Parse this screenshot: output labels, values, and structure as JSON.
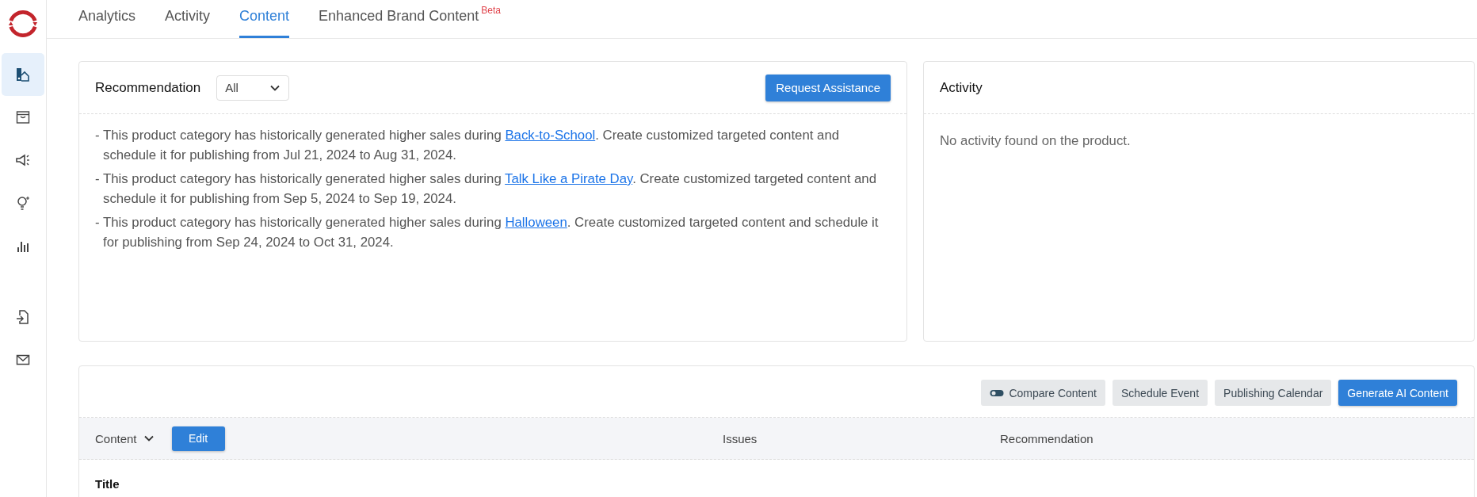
{
  "sidebar": {
    "items": [
      {
        "kind": "swatch",
        "selected": true
      },
      {
        "kind": "archive",
        "selected": false
      },
      {
        "kind": "megaphone",
        "selected": false
      },
      {
        "kind": "bulb",
        "selected": false
      },
      {
        "kind": "chart",
        "selected": false
      },
      {
        "kind": "import",
        "selected": false
      },
      {
        "kind": "mail",
        "selected": false
      }
    ]
  },
  "tabs": [
    {
      "label": "Analytics",
      "selected": false
    },
    {
      "label": "Activity",
      "selected": false
    },
    {
      "label": "Content",
      "selected": true
    },
    {
      "label": "Enhanced Brand Content",
      "selected": false,
      "badge": "Beta"
    }
  ],
  "recommendation": {
    "title": "Recommendation",
    "filter": "All",
    "button": "Request Assistance",
    "items": [
      {
        "before": "- This product category has historically generated higher sales during ",
        "link": "Back-to-School",
        "after": ". Create customized targeted content and schedule it for publishing from Jul 21, 2024 to Aug 31, 2024."
      },
      {
        "before": "- This product category has historically generated higher sales during ",
        "link": "Talk Like a Pirate Day",
        "after": ". Create customized targeted content and schedule it for publishing from Sep 5, 2024 to Sep 19, 2024."
      },
      {
        "before": "- This product category has historically generated higher sales during ",
        "link": "Halloween",
        "after": ". Create customized targeted content and schedule it for publishing from Sep 24, 2024 to Oct 31, 2024."
      }
    ]
  },
  "activity": {
    "title": "Activity",
    "message": "No activity found on the product."
  },
  "content": {
    "toolbar": [
      {
        "label": "Compare Content",
        "kind": "toggle"
      },
      {
        "label": "Schedule Event",
        "kind": "plain"
      },
      {
        "label": "Publishing Calendar",
        "kind": "plain"
      },
      {
        "label": "Generate AI Content",
        "kind": "primary"
      }
    ],
    "columns": [
      "Content",
      "Issues",
      "Recommendation"
    ],
    "edit_button": "Edit",
    "rows": [
      "Title"
    ]
  }
}
